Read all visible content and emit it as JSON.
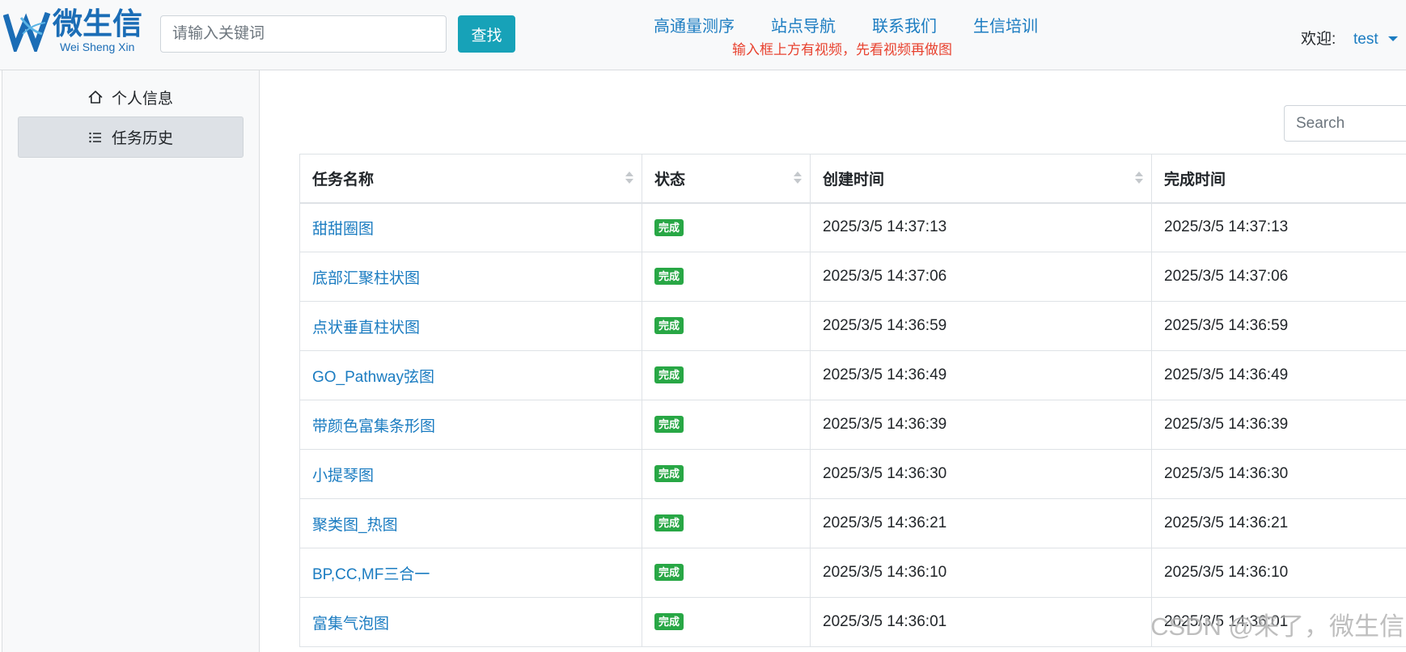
{
  "header": {
    "logo": {
      "title": "微生信",
      "subtitle": "Wei Sheng Xin"
    },
    "search": {
      "placeholder": "请输入关键词",
      "value": ""
    },
    "search_button": "查找",
    "nav": [
      {
        "label": "高通量测序"
      },
      {
        "label": "站点导航"
      },
      {
        "label": "联系我们"
      },
      {
        "label": "生信培训"
      }
    ],
    "notice": "输入框上方有视频，先看视频再做图",
    "welcome_label": "欢迎:",
    "user_name": "test"
  },
  "sidebar": {
    "items": [
      {
        "label": "个人信息",
        "icon": "home-icon",
        "active": false
      },
      {
        "label": "任务历史",
        "icon": "list-icon",
        "active": true
      }
    ]
  },
  "main": {
    "search": {
      "placeholder": "Search"
    },
    "table": {
      "columns": [
        "任务名称",
        "状态",
        "创建时间",
        "完成时间"
      ],
      "rows": [
        {
          "name": "甜甜圈图",
          "status": "完成",
          "created": "2025/3/5 14:37:13",
          "finished": "2025/3/5 14:37:13"
        },
        {
          "name": "底部汇聚柱状图",
          "status": "完成",
          "created": "2025/3/5 14:37:06",
          "finished": "2025/3/5 14:37:06"
        },
        {
          "name": "点状垂直柱状图",
          "status": "完成",
          "created": "2025/3/5 14:36:59",
          "finished": "2025/3/5 14:36:59"
        },
        {
          "name": "GO_Pathway弦图",
          "status": "完成",
          "created": "2025/3/5 14:36:49",
          "finished": "2025/3/5 14:36:49"
        },
        {
          "name": "带颜色富集条形图",
          "status": "完成",
          "created": "2025/3/5 14:36:39",
          "finished": "2025/3/5 14:36:39"
        },
        {
          "name": "小提琴图",
          "status": "完成",
          "created": "2025/3/5 14:36:30",
          "finished": "2025/3/5 14:36:30"
        },
        {
          "name": "聚类图_热图",
          "status": "完成",
          "created": "2025/3/5 14:36:21",
          "finished": "2025/3/5 14:36:21"
        },
        {
          "name": "BP,CC,MF三合一",
          "status": "完成",
          "created": "2025/3/5 14:36:10",
          "finished": "2025/3/5 14:36:10"
        },
        {
          "name": "富集气泡图",
          "status": "完成",
          "created": "2025/3/5 14:36:01",
          "finished": "2025/3/5 14:36:01"
        }
      ]
    }
  },
  "colors": {
    "accent": "#17a2b8",
    "link": "#1b7cc1",
    "success": "#28a745",
    "notice": "#e8422f",
    "logo": "#1b6db6"
  },
  "watermark": "CSDN @来了，微生信"
}
